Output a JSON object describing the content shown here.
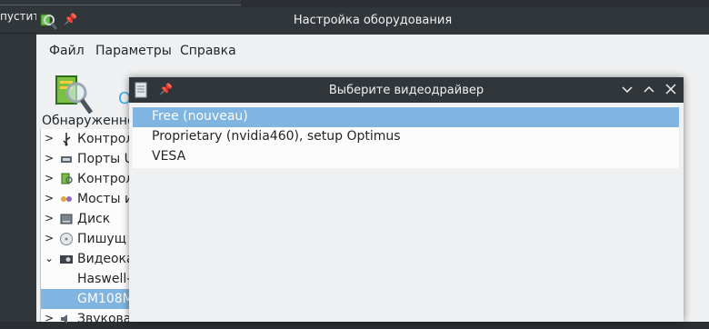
{
  "background_window": {
    "text": "пустит"
  },
  "main_window": {
    "title": "Настройка оборудования",
    "menu": [
      "Файл",
      "Параметры",
      "Справка"
    ],
    "toolbar_text": "О",
    "tree_header": "Обнаруженно",
    "tree_items": [
      {
        "label": "Контрол",
        "icon": "usb-icon",
        "expanded": false,
        "selected": false
      },
      {
        "label": "Порты U",
        "icon": "port-icon",
        "expanded": false,
        "selected": false
      },
      {
        "label": "Контрол",
        "icon": "hardware-config-icon",
        "expanded": false,
        "selected": false
      },
      {
        "label": "Мосты и",
        "icon": "bridge-icon",
        "expanded": false,
        "selected": false
      },
      {
        "label": "Диск",
        "icon": "disk-icon",
        "expanded": false,
        "selected": false
      },
      {
        "label": "Пишущ",
        "icon": "optical-drive-icon",
        "expanded": false,
        "selected": false
      },
      {
        "label": "Видеока",
        "icon": "video-card-icon",
        "expanded": true,
        "selected": false
      },
      {
        "label": "Haswell-",
        "icon": "",
        "expanded": null,
        "selected": false
      },
      {
        "label": "GM108M",
        "icon": "",
        "expanded": null,
        "selected": true
      },
      {
        "label": "Звукова",
        "icon": "speaker-icon",
        "expanded": false,
        "selected": false
      }
    ]
  },
  "dialog": {
    "title": "Выберите видеодрайвер",
    "options": [
      {
        "label": "Free (nouveau)",
        "selected": true
      },
      {
        "label": "Proprietary (nvidia460), setup Optimus",
        "selected": false
      },
      {
        "label": "VESA",
        "selected": false
      }
    ]
  },
  "colors": {
    "titlebar": "#31363b",
    "selection": "#7fb5e0",
    "window_bg": "#eff0f1",
    "accent": "#3daee9"
  }
}
